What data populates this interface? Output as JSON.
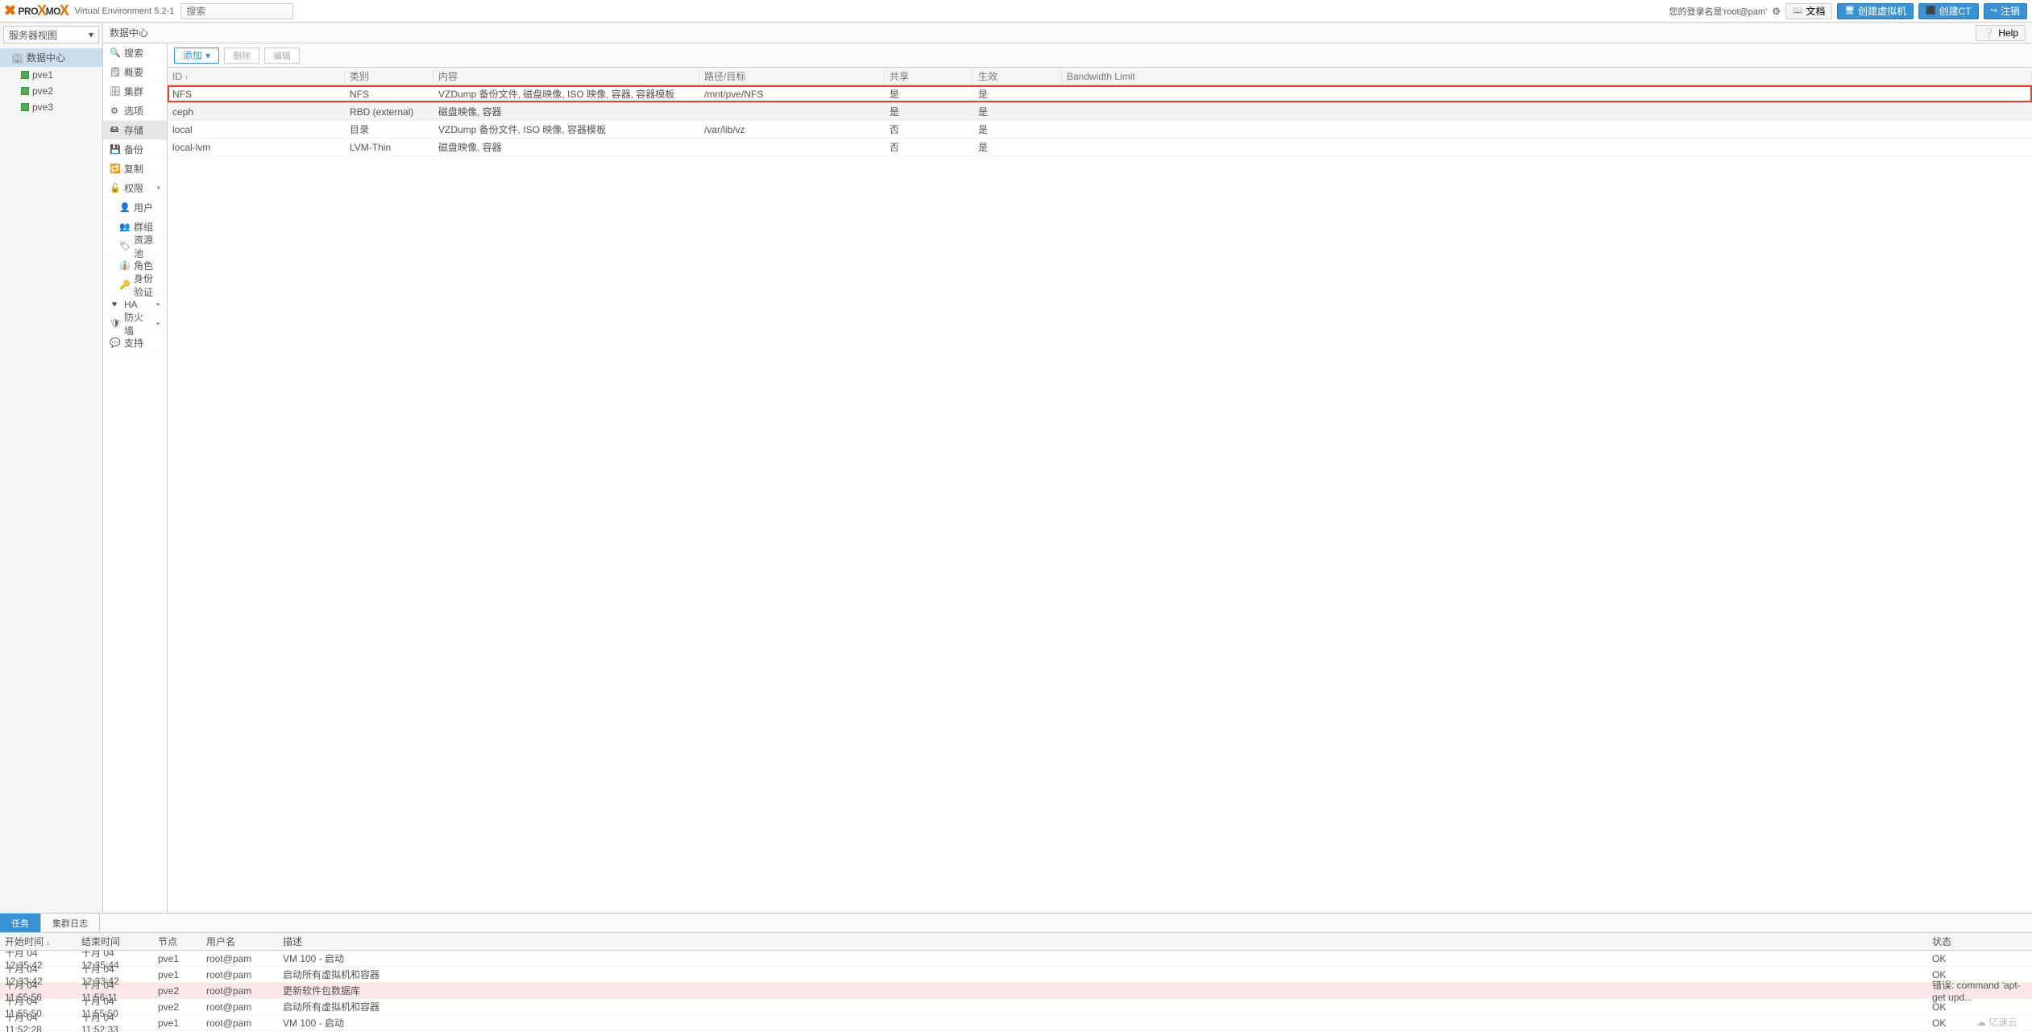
{
  "header": {
    "logo_pre": "PRO",
    "logo_post": "MO",
    "ve": "Virtual Environment 5.2-1",
    "search_ph": "搜索",
    "login": "您的登录名是'root@pam'",
    "btn_doc": "文档",
    "btn_vm": "创建虚拟机",
    "btn_ct": "创建CT",
    "btn_logout": "注销"
  },
  "west": {
    "view": "服务器视图",
    "dc": "数据中心",
    "nodes": [
      "pve1",
      "pve2",
      "pve3"
    ]
  },
  "breadcrumb": "数据中心",
  "help": "Help",
  "submenu": {
    "search": "搜索",
    "summary": "概要",
    "cluster": "集群",
    "options": "选项",
    "storage": "存储",
    "backup": "备份",
    "replication": "复制",
    "perm": "权限",
    "users": "用户",
    "groups": "群组",
    "pools": "资源池",
    "roles": "角色",
    "auth": "身份验证",
    "ha": "HA",
    "fw": "防火墙",
    "support": "支持"
  },
  "toolbar": {
    "add": "添加",
    "remove": "删除",
    "edit": "编辑"
  },
  "storage": {
    "cols": {
      "id": "ID",
      "type": "类别",
      "content": "内容",
      "path": "路径/目标",
      "shared": "共享",
      "enabled": "生效",
      "bw": "Bandwidth Limit"
    },
    "rows": [
      {
        "id": "NFS",
        "type": "NFS",
        "content": "VZDump 备份文件, 磁盘映像, ISO 映像, 容器, 容器模板",
        "path": "/mnt/pve/NFS",
        "shared": "是",
        "enabled": "是",
        "bw": "",
        "hl": true,
        "sel": false
      },
      {
        "id": "ceph",
        "type": "RBD (external)",
        "content": "磁盘映像, 容器",
        "path": "",
        "shared": "是",
        "enabled": "是",
        "bw": "",
        "hl": false,
        "sel": true
      },
      {
        "id": "local",
        "type": "目录",
        "content": "VZDump 备份文件, ISO 映像, 容器模板",
        "path": "/var/lib/vz",
        "shared": "否",
        "enabled": "是",
        "bw": "",
        "hl": false,
        "sel": false
      },
      {
        "id": "local-lvm",
        "type": "LVM-Thin",
        "content": "磁盘映像, 容器",
        "path": "",
        "shared": "否",
        "enabled": "是",
        "bw": "",
        "hl": false,
        "sel": false
      }
    ]
  },
  "log": {
    "tab_tasks": "任务",
    "tab_cluster": "集群日志",
    "cols": {
      "start": "开始时间",
      "end": "结束时间",
      "node": "节点",
      "user": "用户名",
      "desc": "描述",
      "status": "状态"
    },
    "rows": [
      {
        "start": "十月 04 12:35:42",
        "end": "十月 04 12:35:44",
        "node": "pve1",
        "user": "root@pam",
        "desc": "VM 100 - 启动",
        "status": "OK",
        "err": false
      },
      {
        "start": "十月 04 12:33:42",
        "end": "十月 04 12:33:42",
        "node": "pve1",
        "user": "root@pam",
        "desc": "启动所有虚拟机和容器",
        "status": "OK",
        "err": false
      },
      {
        "start": "十月 04 11:55:56",
        "end": "十月 04 11:56:11",
        "node": "pve2",
        "user": "root@pam",
        "desc": "更新软件包数据库",
        "status": "错误: command 'apt-get upd...",
        "err": true
      },
      {
        "start": "十月 04 11:55:50",
        "end": "十月 04 11:55:50",
        "node": "pve2",
        "user": "root@pam",
        "desc": "启动所有虚拟机和容器",
        "status": "OK",
        "err": false
      },
      {
        "start": "十月 04 11:52:28",
        "end": "十月 04 11:52:33",
        "node": "pve1",
        "user": "root@pam",
        "desc": "VM 100 - 启动",
        "status": "OK",
        "err": false
      }
    ]
  },
  "watermark": "亿速云"
}
